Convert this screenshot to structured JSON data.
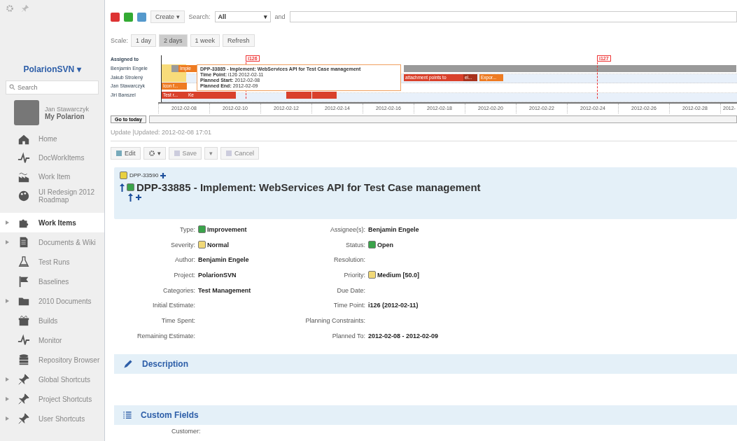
{
  "sidebar": {
    "project": "PolarionSVN",
    "project_caret": "▾",
    "search": {
      "placeholder": "Search"
    },
    "user": {
      "name": "Jan Stawarczyk",
      "link": "My Polarion"
    },
    "favorites": [
      {
        "label": "Home",
        "selected": false
      },
      {
        "label": "DocWorkItems",
        "selected": false
      },
      {
        "label": "Work Item",
        "selected": false
      },
      {
        "label": "UI Redesign 2012 Roadmap",
        "selected": false
      }
    ],
    "nav": [
      {
        "label": "Work Items",
        "selected": true,
        "expandable": true
      },
      {
        "label": "Documents & Wiki",
        "selected": false,
        "expandable": true
      },
      {
        "label": "Test Runs",
        "selected": false,
        "expandable": false
      },
      {
        "label": "Baselines",
        "selected": false,
        "expandable": false
      },
      {
        "label": "2010 Documents",
        "selected": false,
        "expandable": true
      },
      {
        "label": "Builds",
        "selected": false,
        "expandable": false
      },
      {
        "label": "Monitor",
        "selected": false,
        "expandable": false
      },
      {
        "label": "Repository Browser",
        "selected": false,
        "expandable": false
      },
      {
        "label": "Global Shortcuts",
        "selected": false,
        "expandable": true
      },
      {
        "label": "Project Shortcuts",
        "selected": false,
        "expandable": true
      },
      {
        "label": "User Shortcuts",
        "selected": false,
        "expandable": true
      }
    ]
  },
  "toolbar": {
    "create": "Create",
    "caret": "▾",
    "search_label": "Search:",
    "search_value": "All",
    "and_label": "and"
  },
  "scale": {
    "label": "Scale:",
    "buttons": [
      {
        "label": "1 day",
        "selected": false
      },
      {
        "label": "2 days",
        "selected": true
      },
      {
        "label": "1 week",
        "selected": false
      }
    ],
    "refresh": "Refresh"
  },
  "gantt": {
    "header": "Assigned to",
    "rows": [
      {
        "name": "Benjamin Engele",
        "bars": [
          {
            "kind": "grey"
          },
          {
            "kind": "task",
            "label": "Imple"
          },
          {
            "kind": "grey"
          }
        ]
      },
      {
        "name": "Jakub Strolený",
        "bars": [
          {
            "kind": "test",
            "label": "attachment points to"
          },
          {
            "kind": "dark",
            "label": "el..."
          },
          {
            "kind": "task",
            "label": "Expor..."
          }
        ]
      },
      {
        "name": "Jan Stawarczyk",
        "bars": [
          {
            "kind": "task",
            "label": "Icon f..."
          }
        ]
      },
      {
        "name": "Jiri Banszel",
        "bars": [
          {
            "kind": "test",
            "label": "Test r..."
          },
          {
            "kind": "test",
            "label": "Ke"
          },
          {
            "kind": "test"
          },
          {
            "kind": "test"
          },
          {
            "kind": "test"
          }
        ]
      }
    ],
    "milestones": [
      {
        "label": "i126"
      },
      {
        "label": "i127"
      }
    ],
    "dates": [
      "2012-02-08",
      "2012-02-10",
      "2012-02-12",
      "2012-02-14",
      "2012-02-16",
      "2012-02-18",
      "2012-02-20",
      "2012-02-22",
      "2012-02-24",
      "2012-02-26",
      "2012-02-28",
      "2012-"
    ],
    "tooltip": [
      {
        "label": "DPP-33885 - Implement: WebServices API for Test Case management"
      },
      {
        "label": "Time Point:",
        "value": "i126 2012-02-11"
      },
      {
        "label": "Planned Start:",
        "value": "2012-02-08"
      },
      {
        "label": "Planned End:",
        "value": "2012-02-09"
      }
    ],
    "go_today": "Go to today"
  },
  "update": "Update |Updated: 2012-02-08 17:01",
  "actions": [
    {
      "label": "Edit",
      "disabled": false
    },
    {
      "caret": "▾",
      "disabled": false
    },
    {
      "label": "Save",
      "disabled": true
    },
    {
      "caret": "▾",
      "disabled": true
    },
    {
      "label": "Cancel",
      "disabled": true
    }
  ],
  "item": {
    "parent": "DPP-33590",
    "title": "DPP-33885 - Implement: WebServices API for Test Case management"
  },
  "fields_left": [
    {
      "label": "Type:",
      "value": "Improvement",
      "kind": "icon",
      "color": "#3aa34a"
    },
    {
      "label": "Severity:",
      "value": "Normal",
      "kind": "icon",
      "color": "#f0d878"
    },
    {
      "label": "Author:",
      "value": "Benjamin Engele",
      "kind": "text"
    },
    {
      "label": "Project:",
      "value": "PolarionSVN",
      "kind": "text"
    },
    {
      "label": "Categories:",
      "value": "Test Management",
      "kind": "text"
    },
    {
      "label": "Initial Estimate:"
    },
    {
      "label": "Time Spent:"
    },
    {
      "label": "Remaining Estimate:"
    }
  ],
  "fields_right": [
    {
      "label": "Assignee(s):",
      "value": "Benjamin Engele",
      "kind": "text"
    },
    {
      "label": "Status:",
      "value": "Open",
      "kind": "icon",
      "color": "#3aa34a"
    },
    {
      "label": "Resolution:"
    },
    {
      "label": "Priority:",
      "value": "Medium [50.0]",
      "kind": "icon",
      "color": "#f0d878"
    },
    {
      "label": "Due Date:"
    },
    {
      "label": "Time Point:",
      "value": "i126 (2012-02-11)",
      "kind": "text"
    },
    {
      "label": "Planning Constraints:"
    },
    {
      "label": "Planned To:",
      "value": "2012-02-08 - 2012-02-09",
      "kind": "text"
    }
  ],
  "sections": [
    {
      "title": "Description",
      "kind": "description"
    },
    {
      "title": "Custom Fields",
      "kind": "custom"
    }
  ],
  "custom_fields": [
    {
      "label": "Customer:"
    }
  ]
}
